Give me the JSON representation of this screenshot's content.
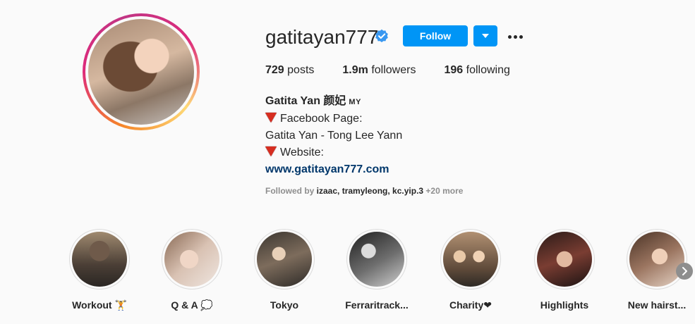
{
  "profile": {
    "username": "gatitayan777",
    "follow_label": "Follow",
    "stats": [
      {
        "count": "729",
        "label": "posts"
      },
      {
        "count": "1.9m",
        "label": "followers"
      },
      {
        "count": "196",
        "label": "following"
      }
    ],
    "bio": {
      "name": "Gatita Yan 颜妃",
      "country": "MY",
      "line1": "Facebook Page:",
      "line2": "Gatita Yan - Tong Lee Yann",
      "line3": "Website:",
      "link": "www.gatitayan777.com"
    },
    "followed_by": {
      "prefix": "Followed by ",
      "users": "izaac, tramyleong, kc.yip.3",
      "more": " +20 more"
    }
  },
  "highlights": [
    {
      "label": "Workout 🏋"
    },
    {
      "label": "Q & A 💭"
    },
    {
      "label": "Tokyo"
    },
    {
      "label": "Ferraritrack..."
    },
    {
      "label": "Charity❤"
    },
    {
      "label": "Highlights"
    },
    {
      "label": "New hairst..."
    }
  ],
  "icons": {
    "verified": "verified-badge-icon",
    "dropdown": "chevron-down-icon",
    "more": "more-options-icon",
    "next": "chevron-right-icon"
  },
  "colors": {
    "accent": "#0095f6",
    "link": "#00376b",
    "muted": "#8e8e8e"
  }
}
